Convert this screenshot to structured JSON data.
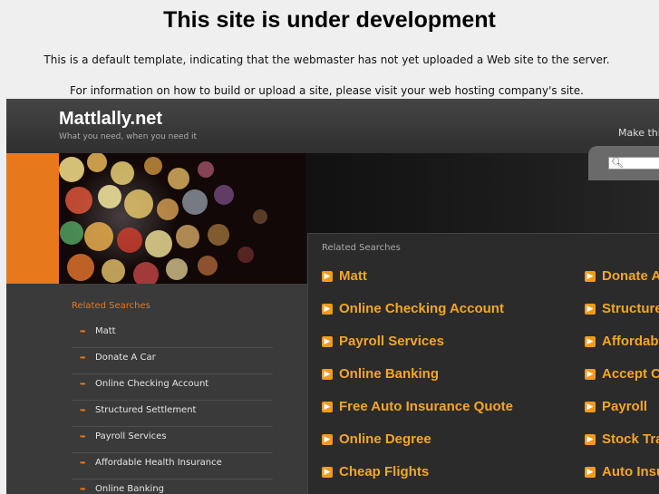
{
  "notice": {
    "title": "This site is under development",
    "line1": "This is a default template, indicating that the webmaster has not yet uploaded a Web site to the server.",
    "line2": "For information on how to build or upload a site, please visit your web hosting company's site."
  },
  "header": {
    "site_title": "Mattlally.net",
    "tagline": "What you need, when you need it",
    "make_link": "Make this"
  },
  "search": {
    "placeholder": ""
  },
  "sidebar": {
    "heading": "Related Searches",
    "items": [
      "Matt",
      "Donate A Car",
      "Online Checking Account",
      "Structured Settlement",
      "Payroll Services",
      "Affordable Health Insurance",
      "Online Banking"
    ]
  },
  "main": {
    "heading": "Related Searches",
    "left": [
      "Matt",
      "Online Checking Account",
      "Payroll Services",
      "Online Banking",
      "Free Auto Insurance Quote",
      "Online Degree",
      "Cheap Flights"
    ],
    "right": [
      "Donate A",
      "Structure",
      "Affordabl",
      "Accept C",
      "Payroll",
      "Stock Tra",
      "Auto Insu"
    ]
  },
  "colors": {
    "accent": "#e8781c",
    "link": "#f5a623",
    "frame_bg": "#3a3a3a"
  }
}
